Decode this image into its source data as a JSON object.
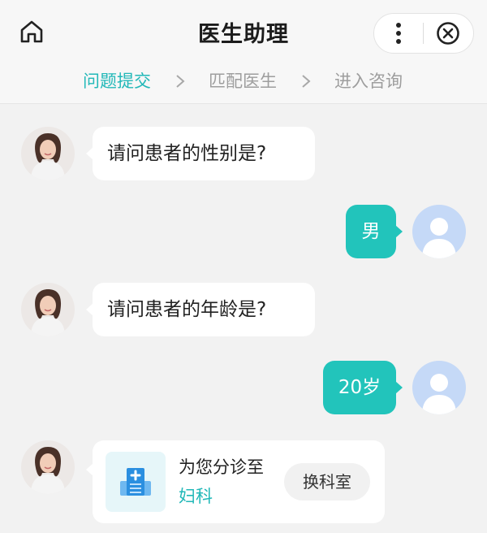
{
  "header": {
    "title": "医生助理",
    "home_icon": "home-icon",
    "more_icon": "more-dots-icon",
    "close_icon": "close-circle-icon"
  },
  "steps": [
    {
      "label": "问题提交",
      "active": true
    },
    {
      "label": "匹配医生",
      "active": false
    },
    {
      "label": "进入咨询",
      "active": false
    }
  ],
  "messages": [
    {
      "from": "doctor",
      "text": "请问患者的性别是?"
    },
    {
      "from": "user",
      "text": "男"
    },
    {
      "from": "doctor",
      "text": "请问患者的年龄是?"
    },
    {
      "from": "user",
      "text": "20岁"
    }
  ],
  "triage_card": {
    "text": "为您分诊至",
    "department": "妇科",
    "switch_label": "换科室",
    "icon": "hospital-icon"
  },
  "colors": {
    "accent": "#22b8b8",
    "user_bubble": "#22c4bb",
    "background": "#f2f2f2"
  }
}
